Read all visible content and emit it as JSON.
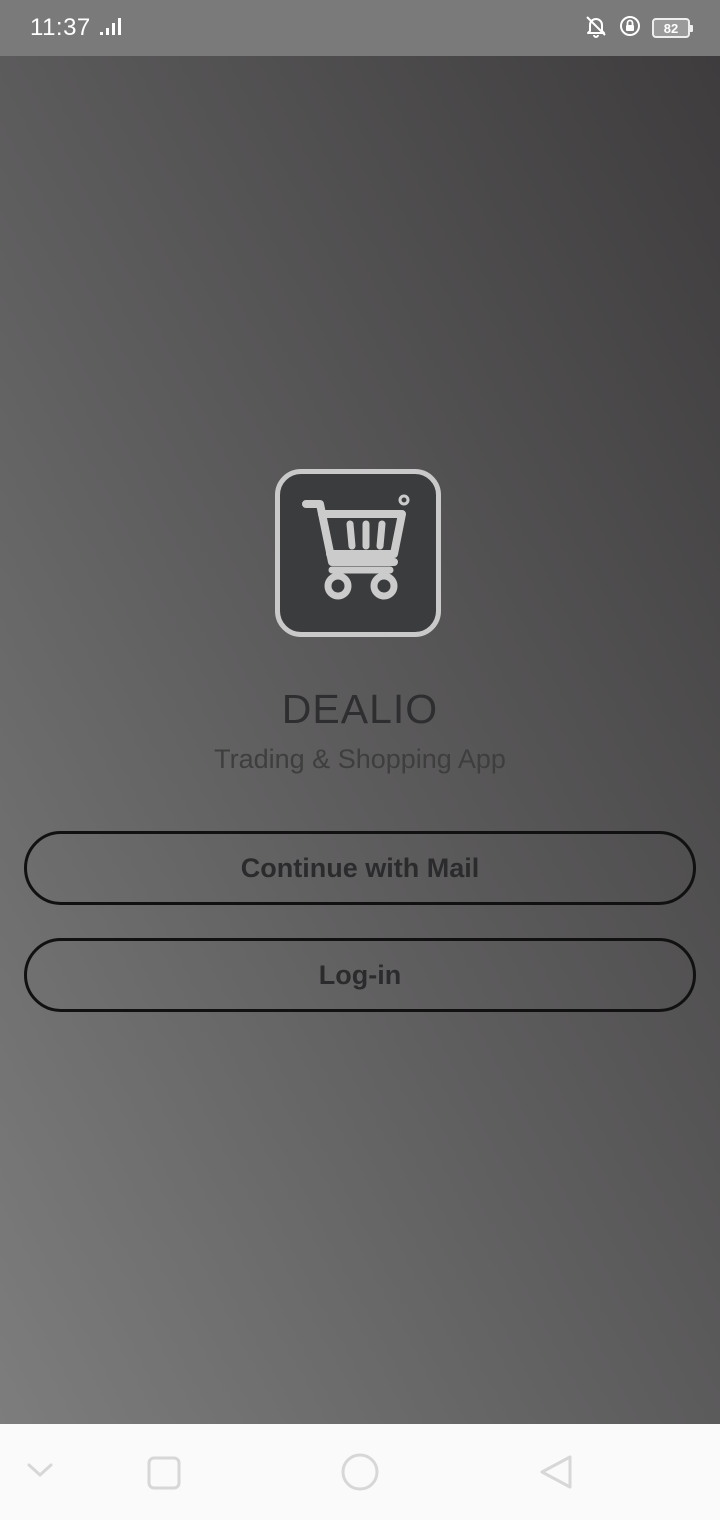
{
  "status_bar": {
    "time": "11:37",
    "battery": "82",
    "icons": [
      "signal-icon",
      "bell-muted-icon",
      "rotation-lock-icon",
      "battery-icon"
    ]
  },
  "app": {
    "logo_icon": "shopping-cart-icon",
    "title": "DEALIO",
    "subtitle": "Trading & Shopping App"
  },
  "actions": {
    "continue_mail": "Continue with Mail",
    "login": "Log-in"
  },
  "nav_bar": {
    "icons": [
      "chevron-down-icon",
      "recents-square-icon",
      "home-circle-icon",
      "back-triangle-icon"
    ]
  },
  "colors": {
    "gradient_light": "#7d7d7d",
    "gradient_dark": "#3e3c3d",
    "logo_bg": "#3b3c3e",
    "logo_fg": "#cbcbcb",
    "text_dark": "#2e2e30"
  }
}
